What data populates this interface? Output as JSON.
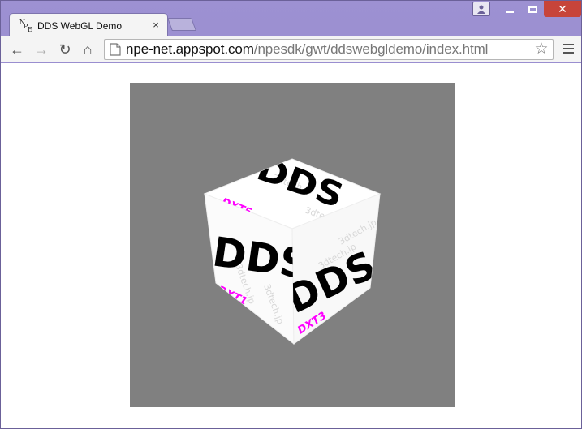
{
  "window": {
    "tab": {
      "favicon_text": [
        "N",
        "P",
        "E"
      ],
      "title": "DDS WebGL Demo",
      "close_glyph": "×"
    },
    "controls": {
      "profile_icon": "person-icon",
      "minimize_icon": "minimize-icon",
      "maximize_icon": "maximize-icon",
      "close_glyph": "✕"
    }
  },
  "toolbar": {
    "back_glyph": "←",
    "forward_glyph": "→",
    "reload_glyph": "↻",
    "home_glyph": "⌂",
    "url_host": "npe-net.appspot.com",
    "url_path": "/npesdk/gwt/ddswebgldemo/index.html",
    "star_glyph": "☆"
  },
  "webgl": {
    "background": "#808080",
    "cube": {
      "top_face": {
        "main": "DDS",
        "format": "DXT5",
        "watermark": "3dtech.jp"
      },
      "left_face": {
        "main": "DDS",
        "format": "DXT1",
        "watermark": "3dtech.jp"
      },
      "right_face": {
        "main": "DDS",
        "format": "DXT3",
        "watermark": "3dtech.jp"
      }
    },
    "colors": {
      "main_text": "#000000",
      "format_text": "#ff00ff",
      "watermark": "#d0d0d0",
      "face": "#ffffff"
    }
  }
}
